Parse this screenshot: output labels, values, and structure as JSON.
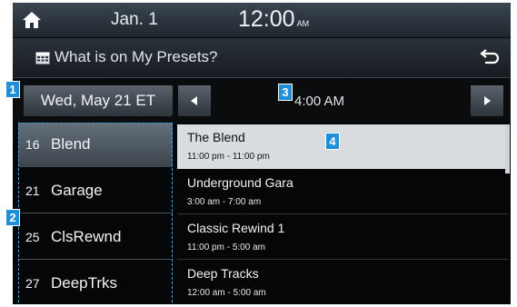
{
  "status_bar": {
    "date": "Jan.  1",
    "time": "12:00",
    "ampm": "AM"
  },
  "title_bar": {
    "title": "What is on My Presets?"
  },
  "nav": {
    "date_label": "Wed, May 21 ET",
    "time_label": "4:00 AM"
  },
  "channels": [
    {
      "number": "16",
      "name": "Blend",
      "selected": true
    },
    {
      "number": "21",
      "name": "Garage",
      "selected": false
    },
    {
      "number": "25",
      "name": "ClsRewnd",
      "selected": false
    },
    {
      "number": "27",
      "name": "DeepTrks",
      "selected": false
    }
  ],
  "programs": [
    {
      "title": "The Blend",
      "time": "11:00 pm - 11:00 pm",
      "selected": true
    },
    {
      "title": "Underground Gara",
      "time": "3:00 am - 7:00 am",
      "selected": false
    },
    {
      "title": "Classic Rewind 1",
      "time": "11:00 pm - 5:00 am",
      "selected": false
    },
    {
      "title": "Deep Tracks",
      "time": "12:00 am - 5:00 am",
      "selected": false
    }
  ],
  "callouts": {
    "c1": "1",
    "c2": "2",
    "c3": "3",
    "c4": "4"
  },
  "colors": {
    "accent": "#1f8fd6",
    "selection": "#d9dde2",
    "background": "#050607"
  }
}
